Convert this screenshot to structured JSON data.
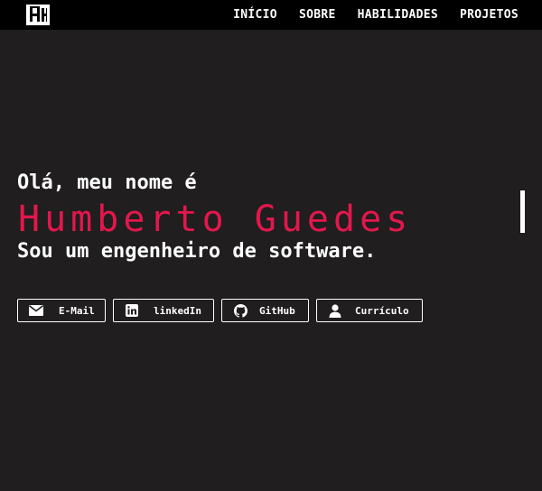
{
  "nav": {
    "logo_icon": "hg-monogram-logo",
    "links": [
      "INÍCIO",
      "SOBRE",
      "HABILIDADES",
      "PROJETOS"
    ]
  },
  "hero": {
    "greeting": "Olá, meu nome é",
    "name": "Humberto Guedes",
    "tagline": "Sou um engenheiro de software."
  },
  "buttons": [
    {
      "label": "E-Mail",
      "icon": "envelope-icon"
    },
    {
      "label": "linkedIn",
      "icon": "linkedin-icon"
    },
    {
      "label": "GitHub",
      "icon": "github-icon"
    },
    {
      "label": "Currículo",
      "icon": "user-icon"
    }
  ],
  "colors": {
    "background": "#201e1f",
    "navbar": "#000000",
    "accent": "#e3174c",
    "text": "#ffffff"
  }
}
